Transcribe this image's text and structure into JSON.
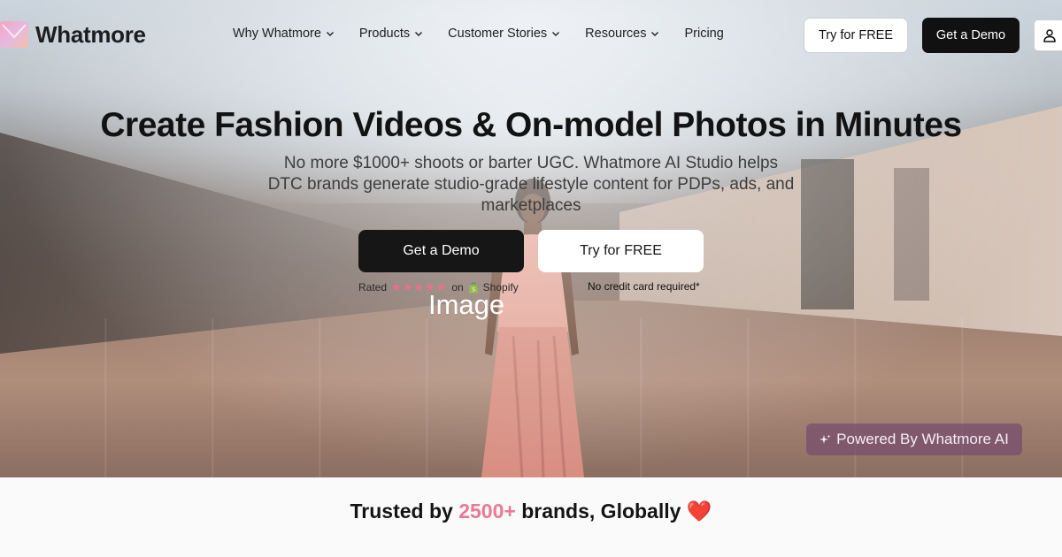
{
  "brand": {
    "name": "Whatmore"
  },
  "nav": {
    "items": [
      {
        "label": "Why Whatmore",
        "has_dropdown": true
      },
      {
        "label": "Products",
        "has_dropdown": true
      },
      {
        "label": "Customer Stories",
        "has_dropdown": true
      },
      {
        "label": "Resources",
        "has_dropdown": true
      },
      {
        "label": "Pricing",
        "has_dropdown": false
      }
    ],
    "try_free_label": "Try for FREE",
    "get_demo_label": "Get a Demo",
    "user_icon": "user-icon"
  },
  "hero": {
    "headline": "Create Fashion Videos & On-model Photos in Minutes",
    "subheadline": "No more $1000+ shoots or barter UGC. Whatmore AI Studio helps DTC brands generate studio-grade lifestyle content for PDPs, ads, and marketplaces",
    "cta_demo_label": "Get a Demo",
    "cta_try_label": "Try for FREE",
    "rating": {
      "prefix": "Rated",
      "stars": "★★★★★",
      "on": "on",
      "platform": "Shopify"
    },
    "no_card_note": "No credit card required*",
    "image_alt_label": "Image",
    "powered_badge": "Powered By Whatmore AI"
  },
  "trusted": {
    "prefix": "Trusted by",
    "count": "2500+",
    "suffix": "brands, Globally",
    "emoji": "❤️"
  },
  "colors": {
    "accent_pink": "#e97a95",
    "dark_button": "#111111",
    "badge_purple": "#7a4e6e"
  }
}
